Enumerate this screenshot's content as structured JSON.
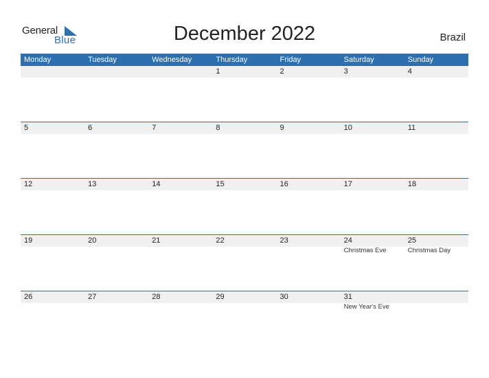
{
  "logo": {
    "general": "General",
    "blue": "Blue",
    "brand_color": "#2e6fb0"
  },
  "title": "December 2022",
  "country": "Brazil",
  "weekdays": [
    "Monday",
    "Tuesday",
    "Wednesday",
    "Thursday",
    "Friday",
    "Saturday",
    "Sunday"
  ],
  "weeks": [
    {
      "days": [
        {
          "num": "",
          "holiday": ""
        },
        {
          "num": "",
          "holiday": ""
        },
        {
          "num": "",
          "holiday": ""
        },
        {
          "num": "1",
          "holiday": ""
        },
        {
          "num": "2",
          "holiday": ""
        },
        {
          "num": "3",
          "holiday": ""
        },
        {
          "num": "4",
          "holiday": ""
        }
      ]
    },
    {
      "days": [
        {
          "num": "5",
          "holiday": ""
        },
        {
          "num": "6",
          "holiday": ""
        },
        {
          "num": "7",
          "holiday": ""
        },
        {
          "num": "8",
          "holiday": ""
        },
        {
          "num": "9",
          "holiday": ""
        },
        {
          "num": "10",
          "holiday": ""
        },
        {
          "num": "11",
          "holiday": ""
        }
      ]
    },
    {
      "days": [
        {
          "num": "12",
          "holiday": ""
        },
        {
          "num": "13",
          "holiday": ""
        },
        {
          "num": "14",
          "holiday": ""
        },
        {
          "num": "15",
          "holiday": ""
        },
        {
          "num": "16",
          "holiday": ""
        },
        {
          "num": "17",
          "holiday": ""
        },
        {
          "num": "18",
          "holiday": ""
        }
      ]
    },
    {
      "days": [
        {
          "num": "19",
          "holiday": ""
        },
        {
          "num": "20",
          "holiday": ""
        },
        {
          "num": "21",
          "holiday": ""
        },
        {
          "num": "22",
          "holiday": ""
        },
        {
          "num": "23",
          "holiday": ""
        },
        {
          "num": "24",
          "holiday": "Christmas Eve"
        },
        {
          "num": "25",
          "holiday": "Christmas Day"
        }
      ]
    },
    {
      "days": [
        {
          "num": "26",
          "holiday": ""
        },
        {
          "num": "27",
          "holiday": ""
        },
        {
          "num": "28",
          "holiday": ""
        },
        {
          "num": "29",
          "holiday": ""
        },
        {
          "num": "30",
          "holiday": ""
        },
        {
          "num": "31",
          "holiday": "New Year's Eve"
        },
        {
          "num": "",
          "holiday": ""
        }
      ]
    }
  ],
  "colors": {
    "header_bg": "#2e6fb0",
    "date_band": "#f0f0f0",
    "week_border": "#2e6fb0"
  }
}
